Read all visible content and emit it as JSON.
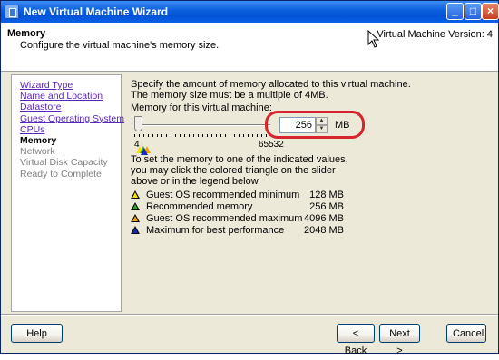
{
  "window": {
    "title": "New Virtual Machine Wizard",
    "controls": {
      "minimize": "_",
      "maximize": "□",
      "close": "×"
    }
  },
  "header": {
    "title": "Memory",
    "subtitle": "Configure the virtual machine's memory size.",
    "version": "Virtual Machine Version: 4"
  },
  "steps": [
    {
      "label": "Wizard Type",
      "state": "link"
    },
    {
      "label": "Name and Location",
      "state": "link"
    },
    {
      "label": "Datastore",
      "state": "link"
    },
    {
      "label": "Guest Operating System",
      "state": "link"
    },
    {
      "label": "CPUs",
      "state": "link"
    },
    {
      "label": "Memory",
      "state": "current"
    },
    {
      "label": "Network",
      "state": "future"
    },
    {
      "label": "Virtual Disk Capacity",
      "state": "future"
    },
    {
      "label": "Ready to Complete",
      "state": "future"
    }
  ],
  "content": {
    "desc_line1": "Specify the amount of memory allocated to this virtual machine.",
    "desc_line2": "The memory size must be a multiple of 4MB.",
    "memory_label": "Memory for this virtual machine:",
    "memory_value": "256",
    "memory_unit": "MB",
    "slider_min": "4",
    "slider_max": "65532",
    "hint": "To set the memory to one of the indicated values, you may click the colored triangle on the slider above or in the legend below.",
    "legend": [
      {
        "label": "Guest OS recommended minimum",
        "value": "128 MB",
        "color": "#F2E200"
      },
      {
        "label": "Recommended memory",
        "value": "256 MB",
        "color": "#2BA82B"
      },
      {
        "label": "Guest OS recommended maximum",
        "value": "4096 MB",
        "color": "#F2A100"
      },
      {
        "label": "Maximum for best performance",
        "value": "2048 MB",
        "color": "#1A2BB0"
      }
    ]
  },
  "footer": {
    "help": "Help",
    "back": "< Back",
    "next": "Next >",
    "cancel": "Cancel"
  }
}
